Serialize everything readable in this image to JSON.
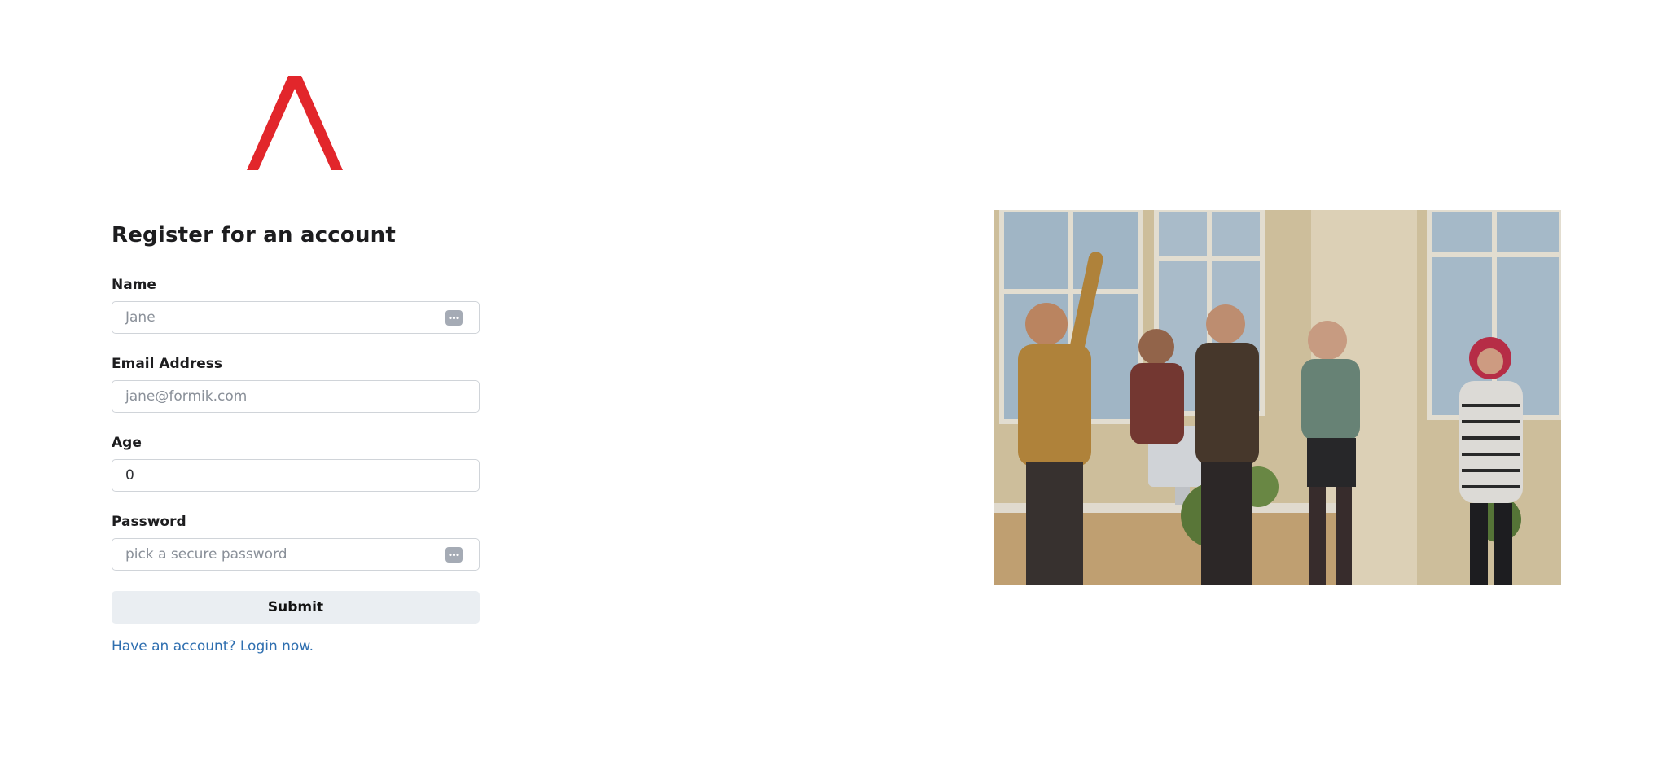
{
  "brand": {
    "logo_color": "#e2262b",
    "logo_icon": "caret-logo"
  },
  "form": {
    "title": "Register for an account",
    "fields": {
      "name": {
        "label": "Name",
        "placeholder": "Jane",
        "value": ""
      },
      "email": {
        "label": "Email Address",
        "placeholder": "jane@formik.com",
        "value": ""
      },
      "age": {
        "label": "Age",
        "placeholder": "",
        "value": "0"
      },
      "password": {
        "label": "Password",
        "placeholder": "pick a secure password",
        "value": ""
      }
    },
    "submit_label": "Submit",
    "login_link": "Have an account? Login now."
  },
  "colors": {
    "link": "#2f6fb0",
    "button_bg": "#eaeef2",
    "input_border": "#d0d4d9"
  },
  "hero_image": {
    "subject": "team-celebrating-photo"
  }
}
